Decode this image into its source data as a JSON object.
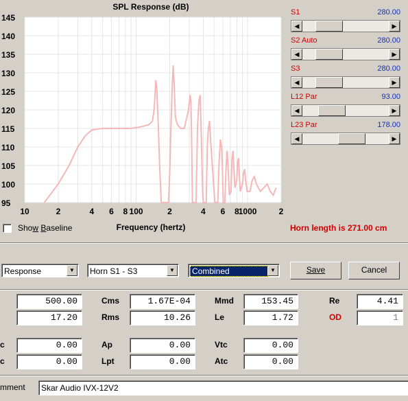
{
  "chart_data": {
    "type": "line",
    "title": "SPL Response (dB)",
    "xlabel": "Frequency (hertz)",
    "ylabel": "",
    "x_scale": "log",
    "xlim": [
      10,
      2000
    ],
    "ylim": [
      95,
      145
    ],
    "y_ticks": [
      "145",
      "140",
      "135",
      "130",
      "125",
      "120",
      "115",
      "110",
      "105",
      "100",
      "95"
    ],
    "x_ticks": [
      "10",
      "2",
      "4",
      "6",
      "8",
      "100",
      "2",
      "4",
      "6",
      "8",
      "1000",
      "2"
    ],
    "grid": true,
    "series": [
      {
        "color": "#f4b8b8",
        "points": [
          [
            15,
            95
          ],
          [
            20,
            100
          ],
          [
            25,
            105
          ],
          [
            30,
            110
          ],
          [
            35,
            113
          ],
          [
            40,
            114.6
          ],
          [
            50,
            115
          ],
          [
            70,
            115
          ],
          [
            90,
            115
          ],
          [
            110,
            115.4
          ],
          [
            130,
            116
          ],
          [
            140,
            117
          ],
          [
            145,
            120
          ],
          [
            150,
            128
          ],
          [
            153,
            126
          ],
          [
            158,
            116
          ],
          [
            163,
            104
          ],
          [
            168,
            95
          ],
          [
            195,
            95
          ],
          [
            200,
            103
          ],
          [
            205,
            115
          ],
          [
            210,
            125
          ],
          [
            215,
            132
          ],
          [
            220,
            126
          ],
          [
            225,
            118
          ],
          [
            235,
            116
          ],
          [
            250,
            115
          ],
          [
            270,
            115
          ],
          [
            285,
            118
          ],
          [
            295,
            120
          ],
          [
            305,
            124
          ],
          [
            310,
            122
          ],
          [
            315,
            112
          ],
          [
            320,
            95
          ],
          [
            345,
            95
          ],
          [
            355,
            115
          ],
          [
            365,
            122
          ],
          [
            375,
            124
          ],
          [
            380,
            118
          ],
          [
            385,
            112
          ],
          [
            395,
            98
          ],
          [
            400,
            95
          ],
          [
            425,
            95
          ],
          [
            435,
            110
          ],
          [
            445,
            115
          ],
          [
            455,
            117
          ],
          [
            465,
            112
          ],
          [
            480,
            106
          ],
          [
            495,
            100
          ],
          [
            510,
            95
          ],
          [
            540,
            95
          ],
          [
            555,
            106
          ],
          [
            570,
            112
          ],
          [
            585,
            110
          ],
          [
            595,
            104
          ],
          [
            605,
            95
          ],
          [
            625,
            95
          ],
          [
            640,
            104
          ],
          [
            655,
            109
          ],
          [
            670,
            104
          ],
          [
            685,
            97
          ],
          [
            710,
            98
          ],
          [
            725,
            107
          ],
          [
            740,
            109
          ],
          [
            755,
            104
          ],
          [
            770,
            99
          ],
          [
            800,
            101
          ],
          [
            815,
            106
          ],
          [
            830,
            107
          ],
          [
            845,
            102
          ],
          [
            860,
            98
          ],
          [
            900,
            100
          ],
          [
            920,
            103
          ],
          [
            940,
            104
          ],
          [
            960,
            101
          ],
          [
            990,
            98
          ],
          [
            1050,
            98
          ],
          [
            1100,
            101
          ],
          [
            1150,
            102
          ],
          [
            1200,
            100
          ],
          [
            1300,
            98
          ],
          [
            1400,
            99
          ],
          [
            1500,
            100
          ],
          [
            1600,
            98
          ],
          [
            1700,
            97
          ],
          [
            1800,
            99
          ]
        ]
      }
    ]
  },
  "right_panel": {
    "sliders": [
      {
        "label": "S1",
        "value": "280.00",
        "position": 0.22
      },
      {
        "label": "S2  Auto",
        "value": "280.00",
        "position": 0.22
      },
      {
        "label": "S3",
        "value": "280.00",
        "position": 0.22
      },
      {
        "label": "L12  Par",
        "value": "93.00",
        "position": 0.27
      },
      {
        "label": "L23  Par",
        "value": "178.00",
        "position": 0.6
      }
    ],
    "horn_length": "Horn length is 271.00 cm"
  },
  "baseline": {
    "label": "Show Baseline",
    "checked": false
  },
  "controls": {
    "combo1": "Response",
    "combo2": "Horn S1 - S3",
    "combo3": "Combined",
    "save": "Save",
    "cancel": "Cancel"
  },
  "params": {
    "row1": [
      {
        "label": "",
        "value": "500.00"
      },
      {
        "label": "Cms",
        "value": "1.67E-04"
      },
      {
        "label": "Mmd",
        "value": "153.45"
      },
      {
        "label": "Re",
        "value": "4.41"
      }
    ],
    "row2": [
      {
        "label": "",
        "value": "17.20"
      },
      {
        "label": "Rms",
        "value": "10.26"
      },
      {
        "label": "Le",
        "value": "1.72"
      },
      {
        "label": "OD",
        "value": "1"
      }
    ],
    "row3": [
      {
        "label": "c",
        "value": "0.00"
      },
      {
        "label": "Ap",
        "value": "0.00"
      },
      {
        "label": "Vtc",
        "value": "0.00"
      }
    ],
    "row4": [
      {
        "label": "c",
        "value": "0.00"
      },
      {
        "label": "Lpt",
        "value": "0.00"
      },
      {
        "label": "Atc",
        "value": "0.00"
      }
    ]
  },
  "comment": {
    "label": "mment",
    "value": "Skar Audio IVX-12V2"
  },
  "colors": {
    "panel_bg": "#d4d0c8",
    "curve": "#f4b8b8",
    "label_red": "#d00000",
    "value_blue": "#1030c0",
    "highlight": "#0a246a"
  }
}
